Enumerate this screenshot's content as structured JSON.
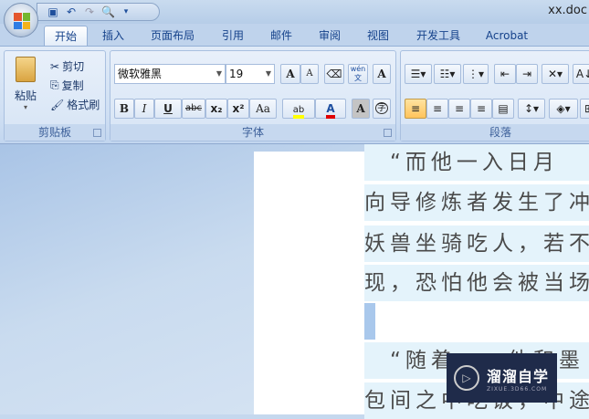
{
  "window": {
    "title": "xx.doc"
  },
  "qat": {
    "icons": [
      "save-icon",
      "undo-icon",
      "redo-icon",
      "print-preview-icon",
      "customize-icon"
    ]
  },
  "tabs": [
    "开始",
    "插入",
    "页面布局",
    "引用",
    "邮件",
    "审阅",
    "视图",
    "开发工具",
    "Acrobat"
  ],
  "clipboard": {
    "paste": "粘贴",
    "cut": "剪切",
    "copy": "复制",
    "format_painter": "格式刷",
    "label": "剪贴板"
  },
  "font": {
    "name": "微软雅黑",
    "size": "19",
    "label": "字体",
    "bold": "B",
    "italic": "I",
    "underline": "U",
    "strike": "abc",
    "sub": "x₂",
    "sup": "x²",
    "case": "Aa",
    "grow": "A",
    "shrink": "A",
    "phonetic": "wén文",
    "border": "A",
    "shade": "A",
    "enclose": "字",
    "highlight_color": "#ffff00",
    "font_color": "#e00000"
  },
  "paragraph": {
    "label": "段落"
  },
  "document": {
    "lines": [
      "　“而他一入日月",
      "向导修炼者发生了冲",
      "妖兽坐骑吃人，若不",
      "现，恐怕他会被当场",
      "",
      "　“随着……他和墨",
      "包间之中吃饭，中途"
    ]
  },
  "watermark": {
    "brand": "溜溜自学",
    "url": "ZIXUE.3D66.COM"
  }
}
